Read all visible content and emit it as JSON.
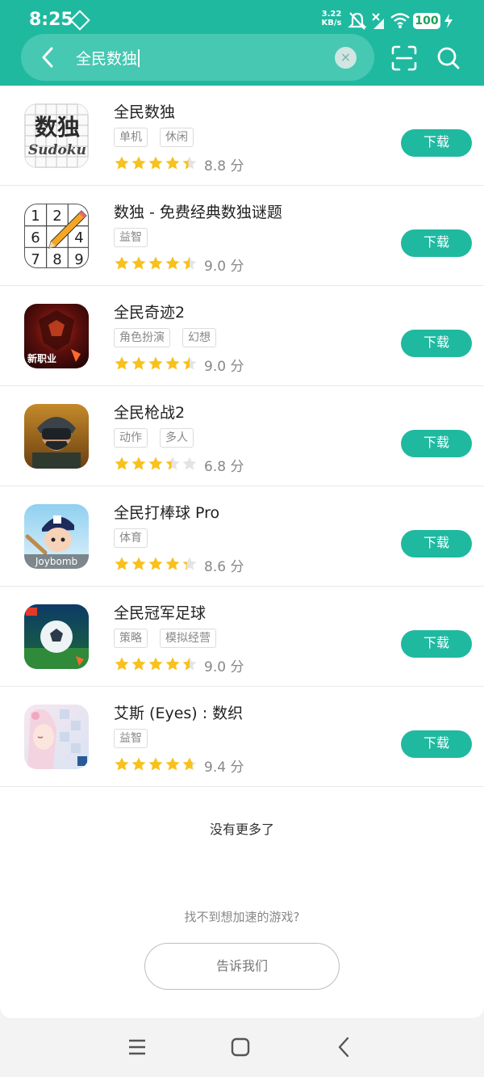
{
  "status": {
    "time": "8:25",
    "net_speed_value": "3.22",
    "net_speed_unit": "KB/s",
    "battery": "100"
  },
  "search": {
    "query": "全民数独",
    "clear_symbol": "×"
  },
  "results": [
    {
      "name": "全民数独",
      "tags": [
        "单机",
        "休闲"
      ],
      "rating": 4.4,
      "score": "8.8 分",
      "button": "下载",
      "icon": "sudoku-photo-icon"
    },
    {
      "name": "数独 - 免费经典数独谜题",
      "tags": [
        "益智"
      ],
      "rating": 4.5,
      "score": "9.0 分",
      "button": "下载",
      "icon": "sudoku-grid-pencil-icon"
    },
    {
      "name": "全民奇迹2",
      "tags": [
        "角色扮演",
        "幻想"
      ],
      "rating": 4.5,
      "score": "9.0 分",
      "button": "下载",
      "icon": "armored-warrior-icon"
    },
    {
      "name": "全民枪战2",
      "tags": [
        "动作",
        "多人"
      ],
      "rating": 3.4,
      "score": "6.8 分",
      "button": "下载",
      "icon": "masked-soldier-icon"
    },
    {
      "name": "全民打棒球 Pro",
      "tags": [
        "体育"
      ],
      "rating": 4.3,
      "score": "8.6 分",
      "button": "下载",
      "icon": "baseball-player-icon"
    },
    {
      "name": "全民冠军足球",
      "tags": [
        "策略",
        "模拟经营"
      ],
      "rating": 4.5,
      "score": "9.0 分",
      "button": "下载",
      "icon": "soccer-ball-icon"
    },
    {
      "name": "艾斯 (Eyes) : 数织",
      "tags": [
        "益智"
      ],
      "rating": 4.7,
      "score": "9.4 分",
      "button": "下载",
      "icon": "anime-girl-icon"
    }
  ],
  "icon_text": {
    "sudoku_title": "数独",
    "sudoku_sub": "Sudoku",
    "grid_numbers": [
      "1",
      "2",
      "",
      "6",
      "",
      "4",
      "7",
      "8",
      "9"
    ],
    "warrior_caption": "新职业",
    "baseball_caption": "Joybomb"
  },
  "footer": {
    "no_more": "没有更多了",
    "cant_find": "找不到想加速的游戏?",
    "tell_us": "告诉我们"
  },
  "colors": {
    "accent": "#1fb9a0",
    "star": "#f8c11c",
    "star_empty": "#e4e4e4"
  }
}
